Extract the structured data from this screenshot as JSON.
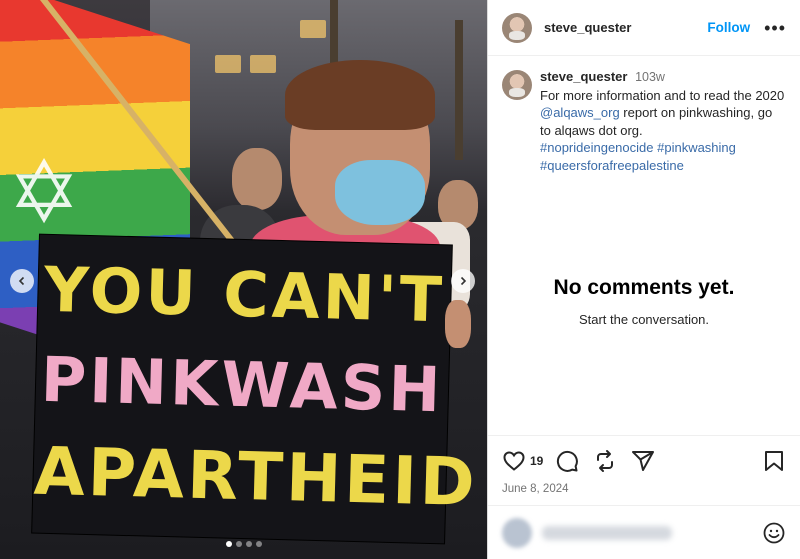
{
  "post": {
    "username": "steve_quester",
    "follow_label": "Follow",
    "more_label": "•••"
  },
  "photo": {
    "sign_line1": "YOU CAN'T",
    "sign_line2": "PINKWASH",
    "sign_line3": "APARTHEID",
    "prev_icon": "chevron-left-icon",
    "next_icon": "chevron-right-icon",
    "slide_count": 4,
    "active_slide": 1
  },
  "caption": {
    "username": "steve_quester",
    "time": "103w",
    "text_before": "For more information and to read the 2020 ",
    "mention": "@alqaws_org",
    "text_after": " report on pinkwashing, go to alqaws dot org.",
    "hashtags": [
      "#nopridein genocide"
    ]
  },
  "hashtags": {
    "h1": "#noprideingenocide",
    "h2": "#pinkwashing",
    "h3": "#queersforafreepalestine"
  },
  "comments": {
    "empty_title": "No comments yet.",
    "empty_subtitle": "Start the conversation."
  },
  "actions": {
    "like_count": "19",
    "date": "June 8, 2024",
    "icons": [
      "heart-icon",
      "comment-icon",
      "repost-icon",
      "share-icon",
      "bookmark-icon",
      "emoji-icon"
    ]
  },
  "colors": {
    "accent": "#0095f6",
    "link": "#3a6ba8",
    "muted": "#737373"
  }
}
